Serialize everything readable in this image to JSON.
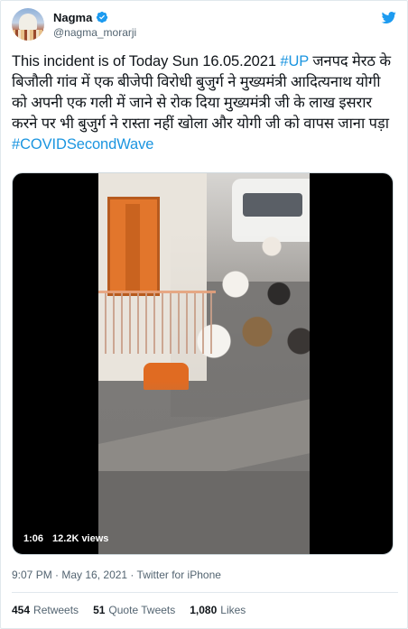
{
  "author": {
    "display_name": "Nagma",
    "handle": "@nagma_morarji",
    "verified": true
  },
  "tweet": {
    "text_plain_1": "This incident is of Today Sun 16.05.2021 ",
    "hashtag_up": "#UP",
    "text_plain_2": " जनपद मेरठ के बिजौली गांव में एक बीजेपी विरोधी बुजुर्ग ने मुख्यमंत्री आदित्यनाथ योगी को अपनी एक गली में जाने से रोक दिया मुख्यमंत्री जी के लाख इसरार करने पर भी बुजुर्ग ने रास्ता नहीं खोला और  योगी जी को वापस जाना पड़ा",
    "hashtag_covid": "#COVIDSecondWave"
  },
  "video": {
    "duration": "1:06",
    "views": "12.2K views"
  },
  "meta": {
    "time": "9:07 PM",
    "separator": " · ",
    "date": "May 16, 2021",
    "source": "Twitter for iPhone"
  },
  "stats": {
    "retweets_count": "454",
    "retweets_label": "Retweets",
    "quotes_count": "51",
    "quotes_label": "Quote Tweets",
    "likes_count": "1,080",
    "likes_label": "Likes"
  },
  "colors": {
    "link": "#1b95e0",
    "verified": "#1d9bf0",
    "twitter_logo": "#1d9bf0",
    "secondary_text": "#536471"
  },
  "icons": [
    "verified-badge-icon",
    "twitter-logo-icon"
  ]
}
